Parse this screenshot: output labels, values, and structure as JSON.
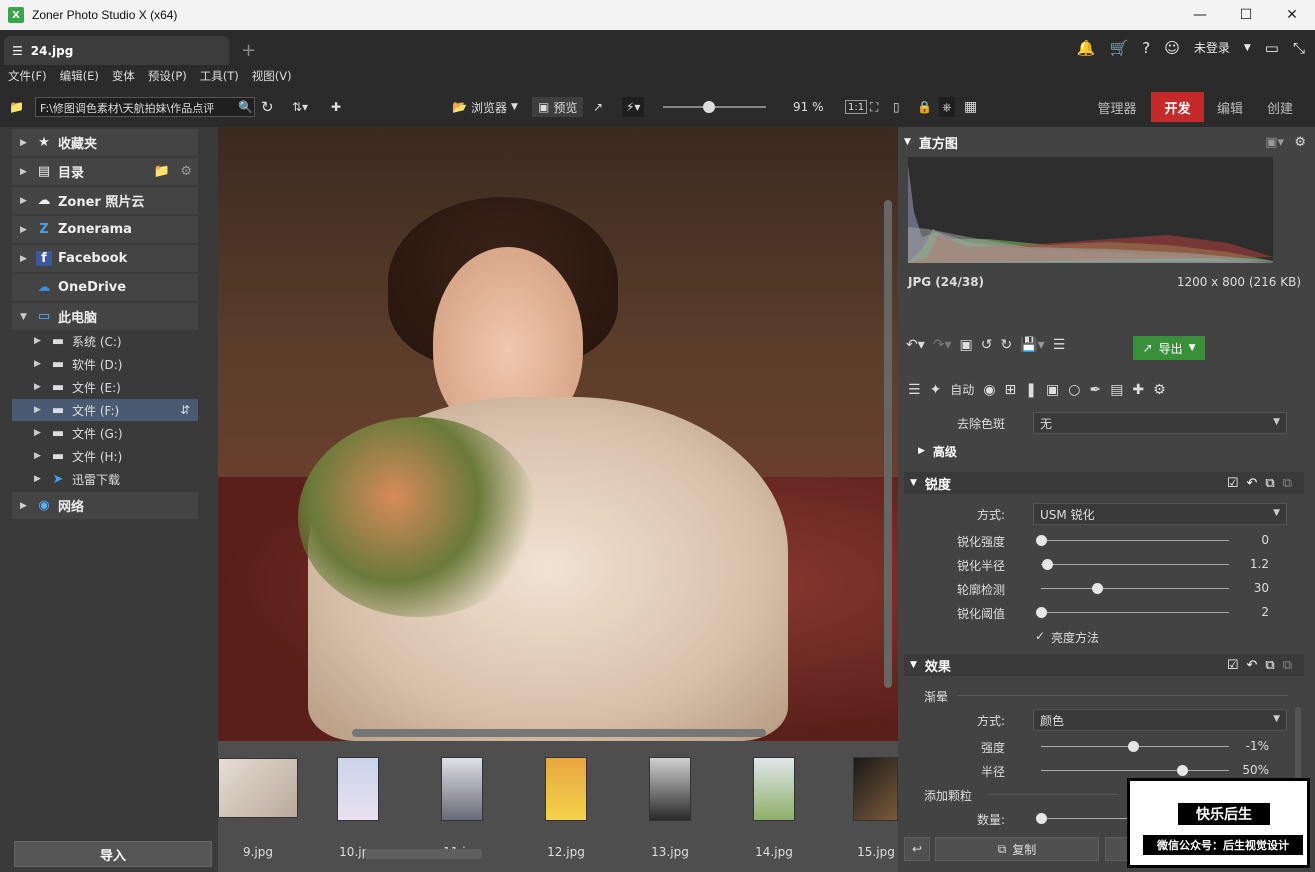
{
  "window": {
    "title": "Zoner Photo Studio X (x64)",
    "app_icon": "X"
  },
  "tabbar": {
    "active_tab": "24.jpg",
    "add_tab": "+",
    "login": "未登录"
  },
  "menu": [
    "文件(F)",
    "编辑(E)",
    "变体",
    "预设(P)",
    "工具(T)",
    "视图(V)"
  ],
  "toolbar": {
    "path": "F:\\修图调色素材\\天航拍妹\\作品点评",
    "browser_label": "浏览器",
    "preview_label": "预览",
    "zoom": "91 %",
    "modes": [
      "管理器",
      "开发",
      "编辑",
      "创建"
    ],
    "active_mode": "开发",
    "zoom_level": 0.45
  },
  "leftpanel": {
    "items": [
      {
        "label": "收藏夹",
        "icon": "star-icon"
      },
      {
        "label": "目录",
        "icon": "catalog-icon"
      },
      {
        "label": "Zoner 照片云",
        "icon": "cloud-icon"
      },
      {
        "label": "Zonerama",
        "icon": "zonerama-icon"
      },
      {
        "label": "Facebook",
        "icon": "facebook-icon"
      },
      {
        "label": "OneDrive",
        "icon": "onedrive-icon"
      },
      {
        "label": "此电脑",
        "icon": "computer-icon"
      }
    ],
    "drives": [
      "系统 (C:)",
      "软件 (D:)",
      "文件 (E:)",
      "文件 (F:)",
      "文件 (G:)",
      "文件 (H:)",
      "迅雷下载"
    ],
    "selected_drive": "文件 (F:)",
    "network": "网络",
    "import_label": "导入"
  },
  "filmstrip": [
    "9.jpg",
    "10.jpg",
    "11.jpg",
    "12.jpg",
    "13.jpg",
    "14.jpg",
    "15.jpg"
  ],
  "rightpanel": {
    "histogram_title": "直方图",
    "file_info": "JPG (24/38)",
    "dimensions": "1200 x 800 (216 KB)",
    "export_label": "导出",
    "auto_label": "自动",
    "defringe_label": "去除色斑",
    "defringe_value": "无",
    "advanced_label": "高级",
    "sharpen": {
      "title": "锐度",
      "method_label": "方式:",
      "method_value": "USM 锐化",
      "sliders": [
        {
          "label": "锐化强度",
          "value": "0",
          "level": 0.0
        },
        {
          "label": "锐化半径",
          "value": "1.2",
          "level": 0.03
        },
        {
          "label": "轮廓检测",
          "value": "30",
          "level": 0.3
        },
        {
          "label": "锐化阈值",
          "value": "2",
          "level": 0.0
        }
      ],
      "checkbox_label": "亮度方法"
    },
    "effects": {
      "title": "效果",
      "vignette_label": "渐晕",
      "method_label": "方式:",
      "method_value": "颜色",
      "strength_label": "强度",
      "strength_value": "-1%",
      "strength_level": 0.49,
      "radius_label": "半径",
      "radius_value": "50%",
      "radius_level": 0.75,
      "grain_label": "添加颗粒",
      "amount_label": "数量:",
      "amount_level": 0.0
    },
    "copy_label": "复制"
  },
  "watermark": {
    "title": "快乐后生",
    "subtitle": "微信公众号：后生视觉设计"
  }
}
